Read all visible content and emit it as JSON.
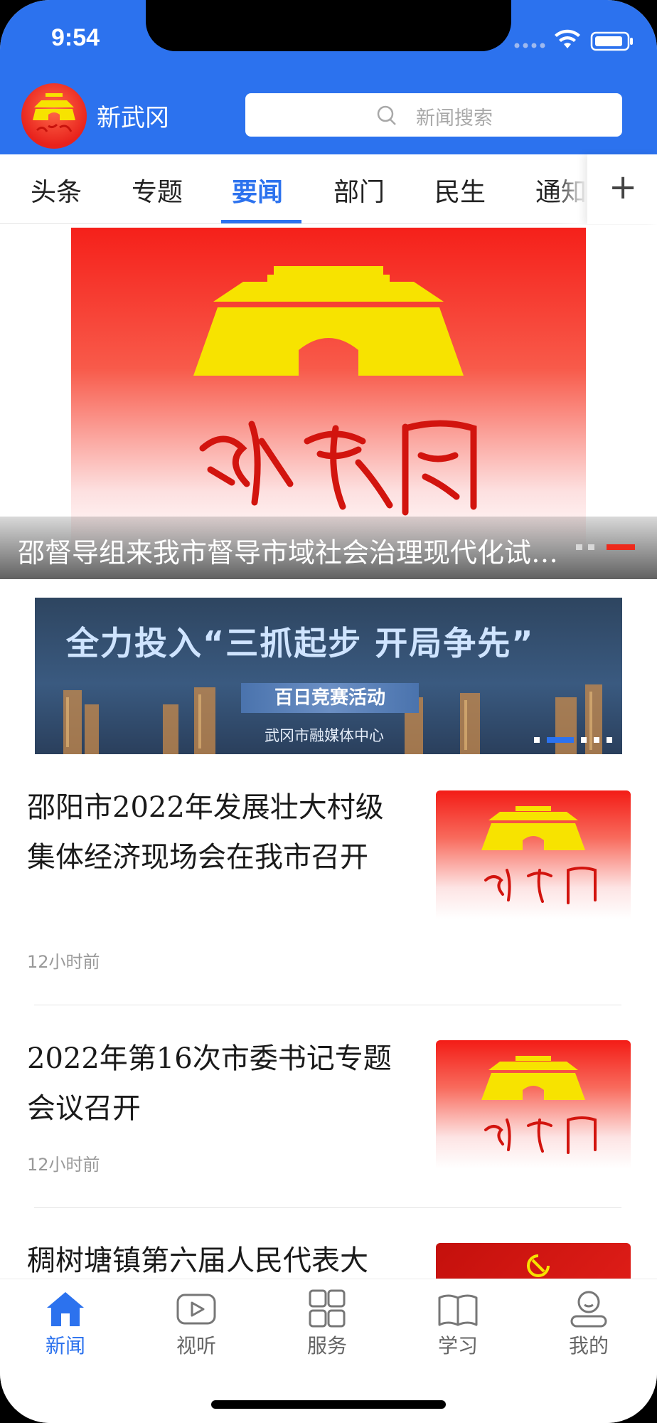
{
  "status_bar": {
    "time": "9:54"
  },
  "header": {
    "app_name": "新武冈",
    "search_placeholder": "新闻搜索"
  },
  "tabs": [
    {
      "label": "头条",
      "active": false
    },
    {
      "label": "专题",
      "active": false
    },
    {
      "label": "要闻",
      "active": true
    },
    {
      "label": "部门",
      "active": false
    },
    {
      "label": "民生",
      "active": false
    },
    {
      "label": "通知",
      "active": false
    }
  ],
  "hero": {
    "caption": "邵督导组来我市督导市域社会治理现代化试点工作",
    "logo_text": "新武冈"
  },
  "banner": {
    "line1": "全力投入“三抓起步 开局争先”",
    "line2": "百日竞赛活动",
    "line3": "武冈市融媒体中心"
  },
  "news": [
    {
      "title": "邵阳市2022年发展壮大村级集体经济现场会在我市召开",
      "time": "12小时前",
      "thumb_text": "新武冈"
    },
    {
      "title": "2022年第16次市委书记专题会议召开",
      "time": "12小时前",
      "thumb_text": "新武冈"
    },
    {
      "title": "稠树塘镇第六届人民代表大",
      "time": "",
      "thumb_text": ""
    }
  ],
  "bottom_nav": [
    {
      "label": "新闻",
      "icon": "home-icon",
      "active": true
    },
    {
      "label": "视听",
      "icon": "play-icon",
      "active": false
    },
    {
      "label": "服务",
      "icon": "grid-icon",
      "active": false
    },
    {
      "label": "学习",
      "icon": "book-icon",
      "active": false
    },
    {
      "label": "我的",
      "icon": "profile-icon",
      "active": false
    }
  ],
  "colors": {
    "brand": "#2c72ee",
    "logo_red": "#e8221c",
    "gate_yellow": "#f7e300"
  }
}
